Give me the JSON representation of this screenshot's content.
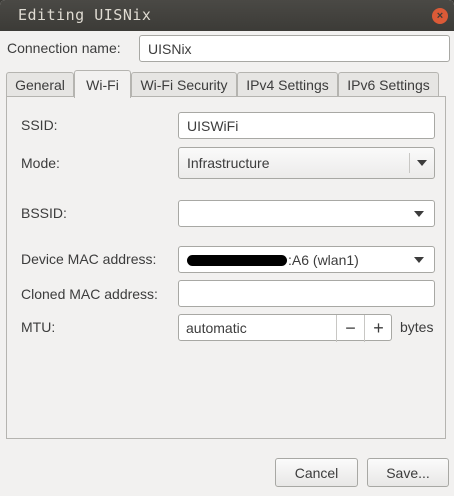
{
  "window": {
    "title": "Editing UISNix",
    "close_glyph": "×"
  },
  "connection": {
    "label": "Connection name:",
    "value": "UISNix"
  },
  "tabs": [
    {
      "label": "General"
    },
    {
      "label": "Wi-Fi"
    },
    {
      "label": "Wi-Fi Security"
    },
    {
      "label": "IPv4 Settings"
    },
    {
      "label": "IPv6 Settings"
    }
  ],
  "active_tab": "Wi-Fi",
  "wifi": {
    "ssid": {
      "label": "SSID:",
      "value": "UISWiFi"
    },
    "mode": {
      "label": "Mode:",
      "value": "Infrastructure"
    },
    "bssid": {
      "label": "BSSID:",
      "value": ""
    },
    "device_mac": {
      "label": "Device MAC address:",
      "value_suffix": ":A6 (wlan1)"
    },
    "cloned_mac": {
      "label": "Cloned MAC address:",
      "value": ""
    },
    "mtu": {
      "label": "MTU:",
      "value": "automatic",
      "minus": "−",
      "plus": "+",
      "unit": "bytes"
    }
  },
  "buttons": {
    "cancel": "Cancel",
    "save": "Save..."
  },
  "colors": {
    "titlebar": "#3c3b37",
    "window_bg": "#f2f1f0",
    "close": "#db5a37"
  }
}
